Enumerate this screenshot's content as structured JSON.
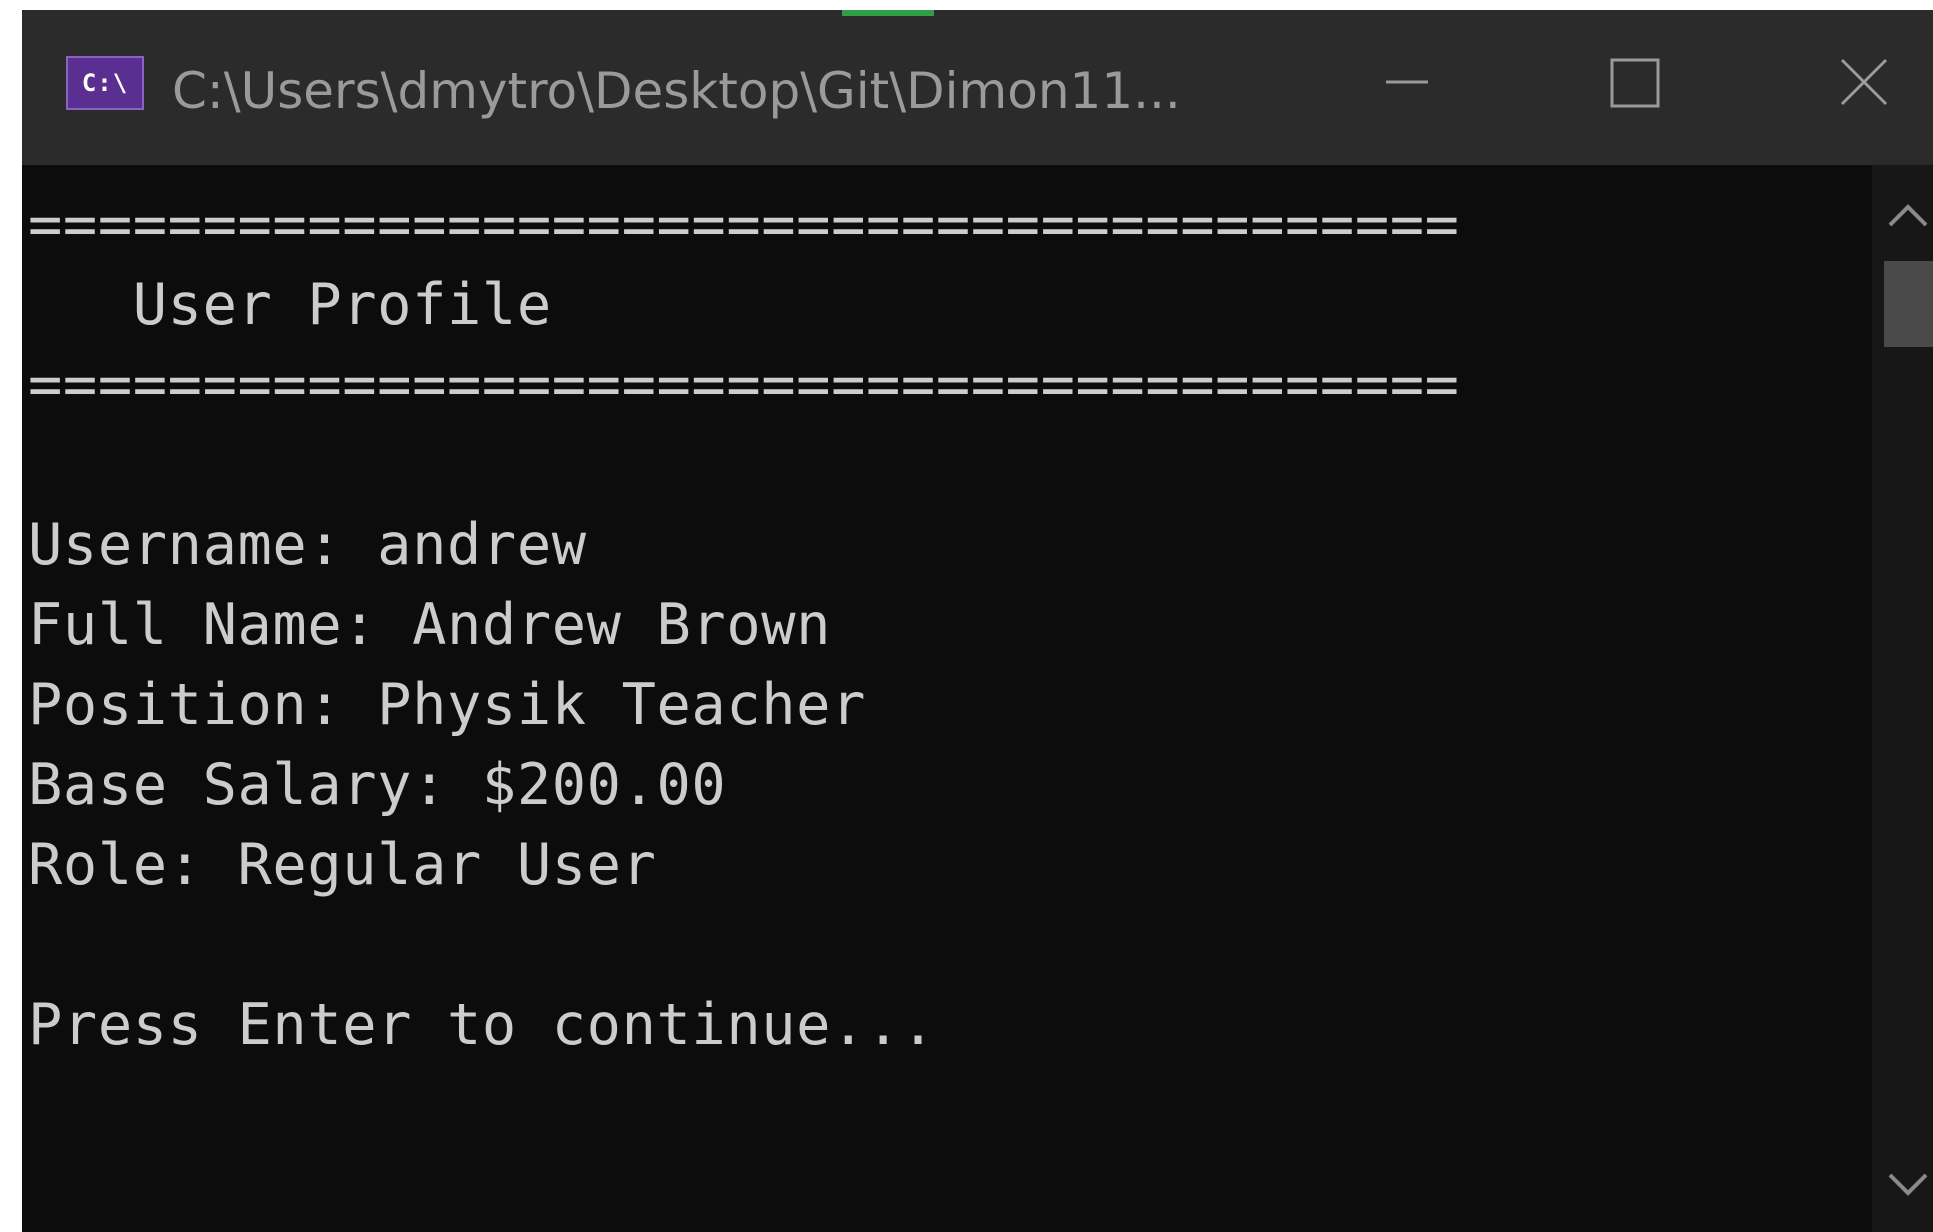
{
  "window": {
    "title": "C:\\Users\\dmytro\\Desktop\\Git\\Dimon11...",
    "icon_text": "C:\\",
    "accent_color": "#2e9e47",
    "icon_color": "#5b2e91"
  },
  "console": {
    "lines": [
      "=========================================",
      "   User Profile",
      "=========================================",
      "",
      "Username: andrew",
      "Full Name: Andrew Brown",
      "Position: Physik Teacher",
      "Base Salary: $200.00",
      "Role: Regular User",
      "",
      "Press Enter to continue..."
    ]
  },
  "icons": {
    "minimize": "minimize-icon",
    "maximize": "maximize-icon",
    "close": "close-icon",
    "scroll_up": "chevron-up-icon",
    "scroll_down": "chevron-down-icon"
  }
}
